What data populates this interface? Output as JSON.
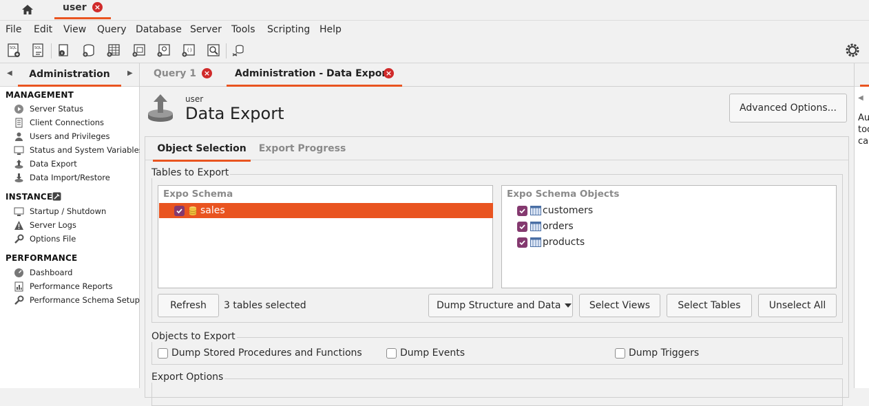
{
  "connection_tabs": [
    {
      "label": "user"
    }
  ],
  "menu": [
    "File",
    "Edit",
    "View",
    "Query",
    "Database",
    "Server",
    "Tools",
    "Scripting",
    "Help"
  ],
  "sidebar": {
    "tab_label": "Administration",
    "sections": {
      "management": {
        "title": "MANAGEMENT",
        "items": [
          "Server Status",
          "Client Connections",
          "Users and Privileges",
          "Status and System Variables",
          "Data Export",
          "Data Import/Restore"
        ]
      },
      "instance": {
        "title": "INSTANCE",
        "items": [
          "Startup / Shutdown",
          "Server Logs",
          "Options File"
        ]
      },
      "performance": {
        "title": "PERFORMANCE",
        "items": [
          "Dashboard",
          "Performance Reports",
          "Performance Schema Setup"
        ]
      }
    }
  },
  "doc_tabs": [
    {
      "label": "Query 1",
      "active": false
    },
    {
      "label": "Administration - Data Export",
      "active": true
    }
  ],
  "page": {
    "connection_name": "user",
    "title": "Data Export",
    "advanced_button": "Advanced Options..."
  },
  "inner_tabs": [
    {
      "label": "Object Selection",
      "active": true
    },
    {
      "label": "Export Progress",
      "active": false
    }
  ],
  "tables_to_export": {
    "group_label": "Tables to Export",
    "schema_header": "Expo Schema",
    "schemas": [
      {
        "name": "sales",
        "checked": true,
        "selected": true
      }
    ],
    "objects_header": "Expo Schema Objects",
    "objects": [
      {
        "name": "customers",
        "checked": true
      },
      {
        "name": "orders",
        "checked": true
      },
      {
        "name": "products",
        "checked": true
      }
    ],
    "refresh_button": "Refresh",
    "status_text": "3 tables selected",
    "dump_select": "Dump Structure and Data",
    "select_views_button": "Select Views",
    "select_tables_button": "Select Tables",
    "unselect_all_button": "Unselect All"
  },
  "objects_to_export": {
    "group_label": "Objects to Export",
    "options": [
      {
        "label": "Dump Stored Procedures and Functions",
        "checked": false
      },
      {
        "label": "Dump Events",
        "checked": false
      },
      {
        "label": "Dump Triggers",
        "checked": false
      }
    ]
  },
  "export_options": {
    "group_label": "Export Options"
  },
  "right_pane": {
    "text_lines": [
      "Au",
      "too",
      "car"
    ]
  },
  "colors": {
    "accent": "#e95420",
    "checkbox": "#84396f",
    "close": "#d02a2a"
  }
}
